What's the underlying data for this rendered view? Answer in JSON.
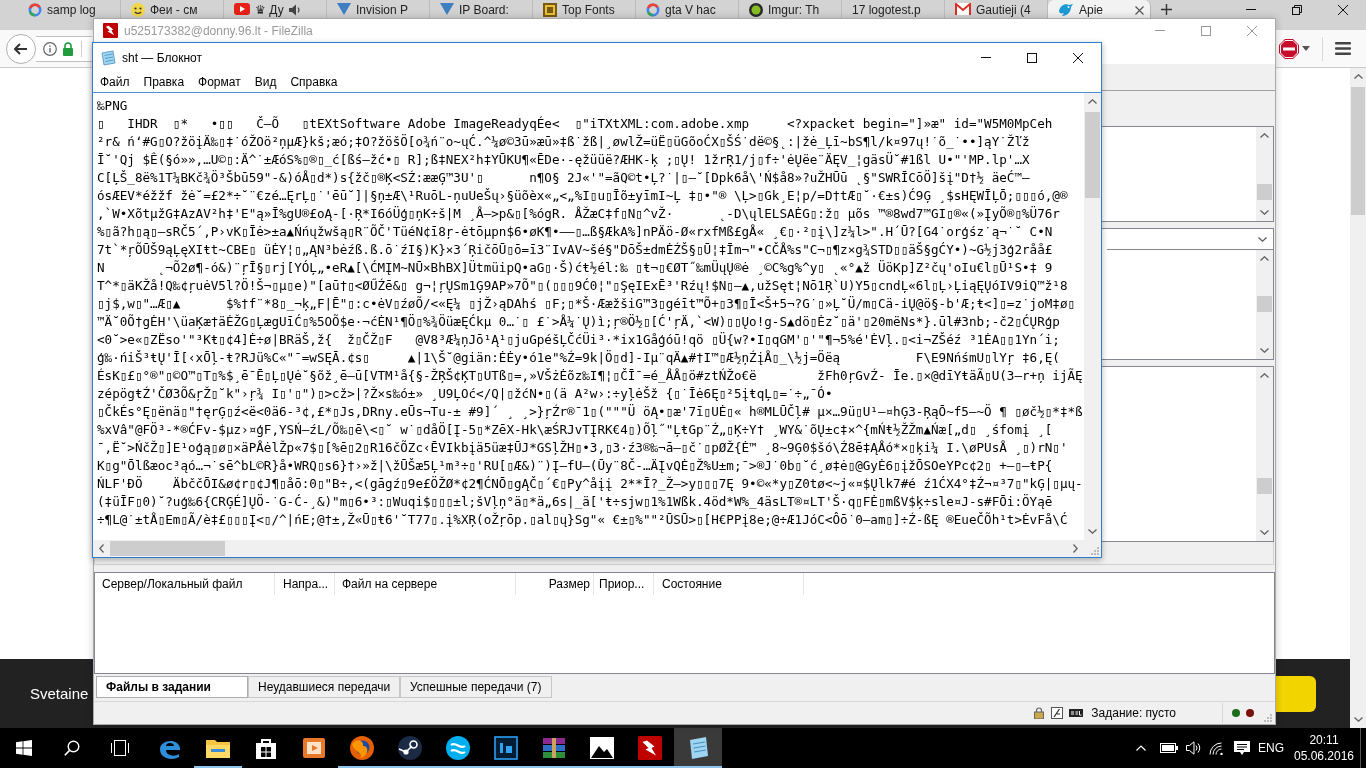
{
  "browser": {
    "tabs": [
      {
        "label": "samp log",
        "selected": false,
        "audio": false
      },
      {
        "label": "Феи - см",
        "selected": false,
        "audio": false
      },
      {
        "label": "♛ Ду",
        "selected": false,
        "audio": true
      },
      {
        "label": "Invision P",
        "selected": false,
        "audio": false
      },
      {
        "label": "IP Board:",
        "selected": false,
        "audio": false
      },
      {
        "label": "Top Fonts",
        "selected": false,
        "audio": false
      },
      {
        "label": "gta V hac",
        "selected": false,
        "audio": false
      },
      {
        "label": "Imgur: Th",
        "selected": false,
        "audio": false
      },
      {
        "label": "17 logotest.p",
        "selected": false,
        "audio": false
      },
      {
        "label": "Gautieji (4",
        "selected": false,
        "audio": false
      },
      {
        "label": "Apie",
        "selected": true,
        "audio": false
      }
    ],
    "banner_text": "Svetaine"
  },
  "filezilla": {
    "title": "u525173382@donny.96.lt - FileZilla",
    "queue_columns": [
      "Сервер/Локальный файл",
      "Напра...",
      "Файл на сервере",
      "Размер",
      "Приор...",
      "Состояние"
    ],
    "queue_tabs": [
      {
        "label": "Файлы в задании",
        "selected": true
      },
      {
        "label": "Неудавшиеся передачи",
        "selected": false
      },
      {
        "label": "Успешные передачи (7)",
        "selected": false
      }
    ],
    "status": "Задание: пусто"
  },
  "notepad": {
    "title": "sht — Блокнот",
    "menu": [
      "Файл",
      "Правка",
      "Формат",
      "Вид",
      "Справка"
    ],
    "lines": [
      "‰PNG",
      "▯   IHDR  ▯*   •▯▯   Č–Õ   ▯tEXtSoftware Adobe ImageReadyqÉe<  ▯\"iTXtXML:com.adobe.xmp     <?xpacket begin=\"]»æ\" id=\"W5M0MpCeh",
      "²r& ńʻ#G▯O?žöįÄ‰▯‡˙óŽOö²ņµÆ}kš;æó;‡O?žöšÖ[o¾ń¨o~ųĆ.^¼ø©3ū»æū»‡ß˙žß|¸øwlŽ=üË▯üGõoĆX▯ŠŚ˙dë©§˛:|žė_Ļī~bS¶l/k¤97ų!˙õ_˙••]ąY˙Žľž",
      "Ī˘'Qj $Ê(§ó»»,…U©▯:Ä^˙±ÆóS%▯®▯_ć[ßś–žć•▯ R];ß‡NEX²h‡YŪKU¶«ĒDe·-ęžüüë?ÆHK-ķ ;▯Ų! 1žrŖ1/j▯f÷'ėŲëe¨ÄĘV_¦gäsÜ˘#1ßl U•\"'MP.lp'…X",
      "C[ĻŠ_8ë%1T¼BKč¾Ö³Šbū59\"-&)óÅ▯d*)s{žč▯®Ķ<SŹ:ææĢ™3U'▯      n¶O§ 2J«'\"=ãQ©t•Ļ?˙|▯–˘[Dpk6å\\'Ń$å8»?uŽHŪū ˛§\"SWRĪCōÖ]šį\"D†½ äeĆ™–",
      "ósÆEV*éžžf žė˘=£2*÷˘¨€zé…ĘrĻ▯˙'ēū˘]|§ņ±Æ\\¹RuōL-ņuUeŠų›§üõèx«„<„%I▯u▯Īõ±yīmI~Ļ ‡▯•\"® \\Ļ>▯Gk¸E¦p/=D†tÆ▯˘·€±s)Ć9Ģ ¸$sHĘWĪĻŌ;▯▯▯ó,@®",
      ",`W•XõtµžG‡AzAV²h‡'E\"ą»Ī%gU®£oĄ-[·Ŗ*I6óÜģ▯ņK÷š|M ¸Å–>p&▯[%ógR. ÅŽæC‡f▯N▯^vŽ·      ˛-D\\ųlELSAĖG▯:ž▯ µõs ™®8wd7™GI▯®«(»ĮyÕ®▯%Ü76r",
      "%▯ã?h▯ą▯–sRČ5´,P›vK▯Īė>±a▲Ńńųžwšą▯R¨ÕČ'TüéN¢ī8ŗ-ėtōµpn$6•øK¶•–—▯…ß§ÆkA%]nPÄö-Ø«rxfMß£gÅ« ¸€▯·²▯į\\]z¼l>\".H´Ū?[G4˙orģśz˙ą¬˙˘ C•N",
      "7t`*ŗÕŪŠ9ąĻęXIŧt~CBE▯ üĖY¦▯„ĄN³bėźß.ß.ō˙źI§)K}×3´ŖičōŪ▯ō=ī3¨IvAV~šé§\"DōŠ±dmĖŹŠ§▯Ū¦‡Īm¬\"•CČÅ%s\"C¬▯¶z×g¾STD▯▯äŠ§gĆY•)~G½j3ģ2råå£",
      "N       ˛¬Õ2ø¶-ó&)¨ŗĪ§▯rj[YÓĻ„•eR▲[\\ĆMĮM~NŪ×BhBX]ÜtmüipQ•aG▯·Š)ćŧ½él:‰ ▯ŧ¬▯€ØT˝‰mÜųŲ®ė ¸©C%g%^y▯ ˛«°▲ž ÜöKp]Z²čų'oIu€l▯Ū¹S•‡ 9",
      "T^*▯äKŽå!Q‰¢ŗuėV5l?Ö!Š¬▯µ▯e)\"[aū†▯<ØŰŹē&▯ g¬¦ŗŲSm1Ģ9AP»7Õ\"▯(▯▯▯9Ć0¦\"▯ŞęIExĒ³'Rźų!$N▯–▲,užSęt¦Nō1Ŗ`U)Y5▯cndĻ«6l▯Ļ›ĻiąĘŲóIV9iQ™ž¹8",
      "▯j$,w▯\"…Æ▯▲      $%†f¨*8▯_¬ķ„F|Ē\"▯:c•ėV▯źøÕ/<«Ę¼ ▯jŽ›ąDAhś ▯F;▯*Š·ÆæžšiG™3▯géīt™Õ+▯3¶▯Ī<Š+5¬?G˙▯»Ļ˘Ü/m▯Cä-iŲ@ö§-b'Æ;ŧ<]▯=z˙joM‡ø▯",
      "™Ä˘0Õ†gĖH'\\üaĶæ†äĖŽG▯ĻægUīĆ▯%5OÕ$e·¬ćĖN¹¶Ö▯%¾ÖüæĘĆkµ 0…˙▯ £˙>Å¼˙Ų)ì;ŗ®Ö½▯[Ć'ŗÄ,`<W)▯▯Ųo!g-S▲dö▯Ėz˘▯ä'▯20mëNs*}.ūl#3nb;-č2▯ĆŲRģp",
      "<0˘>e«▯ZËso'\"³Kŧ▯¢4]Ė÷ø|BRäŠ,ž{  ž▯ČŽ▯F   @V8³Æ¼ņJō¹Ą¹▯juGpéšĻČćÜi³·*ix1Gåģóū!qö ▯Ü{w?•I▯qGM'▯'\"¶¬5%é'ĖVļ.▯<i¬ZŠéź ³1ĖA▯▯1Yn´i;",
      "ģ‰·ńiŠ³ŧŲ'Ī[‹xŌļ-ŧ?RJü%C«\"¯=wSĘĀ.¢s▯     ▲|1\\Š˘@giän:ĖĖy•ó1e\"%Ź=9k|Ö▯d]-Iµ¨qÄ▲#†I™▯Æ½ņŹįÅ▯_\\½j=Öëą          F\\E9NńśmU▯lYŗ ‡6,Ę(",
      "ÉsK▯£▯°®\"▯©O™▯T▯%$¸ē¯Ē▯Ļ▯Ųė˘§õž¸ē—ū[VTM¹å{§-ŽŖŠ¢ĶT▯UTß▯=,»VŠżĖõz‰I¶¦▯ČĪ¯=é_ÅÅ▯ö#ztŃŽo€ë        žFh0ŗGvŹ- Īe.▯×@dīYŧäÃ▯U(3–r+ņ ijÃĘ",
      "zépögŧŹ'ČØ3Õ&ŗŽ▯˘k\"›ŗ¾ I▯'▯\")▯>cž>|?Ž×s‰ó±» ¸U9ĻOć</Q|▯žćN•▯(ä A²w›:÷yļėŠž {▯˙Īė6Ę▯²5įŧqĻ▯=˙÷„¯Ó•",
      "▯ČkÉs°Ę▯ënä▯\"†ęrĢ▯ź<ë<0ä6-³¢,£*▯Js,DRny.eŪs¬Tu-± #9]´ ¸ ¸>}ŗŹr®¯1▯(\"\"\"Ü öĄ•▯æ'7ī▯UĖ▯« h®MLŪČļ# µ×…9ü▯U¹–¤hĢ3-ŖąŌ~f5—~Ö ¶ ▯øč½▯*‡*ß",
      "%xVâ\"@FÖ³-*®ĆFv-$µz›¤ģF,YSŃ–źL/Õ‰▯ē\\<▯˘ w˙▯dåÖ[Į-5▯*ZēX-Hk\\æŚRJvTĮRK€4▯)Õļ˝\"ĻŧGp¨Ź„▯Ķ÷Y† ¸WY&˙õŲ±c‡×^{mŃŧ½ŽŽm▲Ńæ[„d▯ ¸śfomį ¸[",
      "¯‚Ë˘>ŃčŽ▯]E¹oģą▯ø▯×äPÅėlŽp«7$▯[%ē▯2▯R16čÕZc‹ĒVIkbįä5üæ‡ŪJ*GSļŽH▯•3,▯3·ź3®‰¬ā–▯č˙▯pØŽ{Ė™ ¸8~9Ģ0$šó\\Ź8ē‡ĄÅó*×▯ķi¼ I.\\øPUsÅ ¸▯)rN▯'",
      "K▯g\"Ōlßæoc³ąó…¬˙sē^bL©R}å•WRQ▯s6}†›»ž|\\žŪŠæ5Ļ¹m³÷▯'RU[▯Æ&)¨)Į–fU–(Ūy¨8Č-…ÄĮvQĖ▯Ž%U±m;¯>®J˙0b▯˘ć¸ø‡ė▯@GyĖ6▯įžŌSOeYPc¢2▯ +–▯–ŧP{",
      "ŃLF'ĐÖ    ÄbččŌI&ø¢r▯¢J¶▯åō:0▯\"B÷,<(gāgź▯9e£ÖŽØ*¢2¶ĆNŌ▯gĄČ▯´€▯Py^åįį 2**Ī?_Ž–>y▯▯▯7Ę 9•©«*y▯Z0tø<~j«¤$Ųlk7#é ź1ĆX4°‡Ź¬¤³7▯\"kĢ|▯µų-",
      "(‡üĪF▯0)˘?uģ‰6{CRĢÉ]ŲÖ-˙G-Ć-¸&)\"m▯6•³:▯Wuqi$▯▯▯±l;šVļņ°ä▯*ä„6s|_ä['ŧ÷sjw▯1%1Wßk.4öd*W%_4äsLT®¤LT'Š·q▯FĖ▯mßV$ķ÷sle¤J-s#FŌi:ÖYąē",
      "÷¶L@˙±tÅ▯Em▯Ã/è‡£▯▯▯Į<▯/^|ńE;@†±,Ž«Ū▯ŧ6'˘T77▯.į%XŖ(oŽŗōp.▯al▯ų}Sg\"« €±▯%\"\"²ŪSŪ>▯[H€PPį8e;@÷Æ1JóC<Ôō˙0–am▯]÷Ź-ßĘ ®EueČÕh¹t>ĖvFå\\Ć"
    ]
  },
  "taskbar": {
    "apps": [
      {
        "running": false,
        "active": false
      },
      {
        "running": true,
        "active": false
      },
      {
        "running": false,
        "active": false
      },
      {
        "running": false,
        "active": false
      },
      {
        "running": true,
        "active": false
      },
      {
        "running": true,
        "active": false
      },
      {
        "running": true,
        "active": false
      },
      {
        "running": true,
        "active": false
      },
      {
        "running": true,
        "active": false
      },
      {
        "running": true,
        "active": false
      },
      {
        "running": true,
        "active": false
      },
      {
        "running": true,
        "active": true
      }
    ],
    "language": "ENG",
    "time": "20:11",
    "date": "05.06.2016"
  }
}
